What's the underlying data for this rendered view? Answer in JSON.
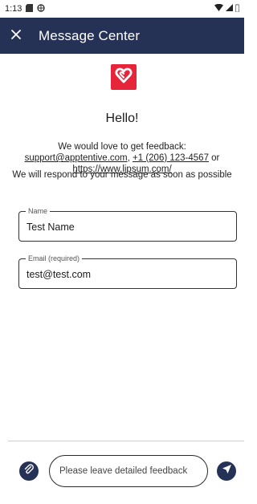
{
  "status_bar": {
    "time": "1:13",
    "icons": [
      "sd-card-icon",
      "vpn-icon",
      "wifi-icon",
      "signal-icon",
      "battery-icon"
    ]
  },
  "app_bar": {
    "title": "Message Center",
    "close_icon": "close-icon",
    "background": "#253155"
  },
  "content": {
    "logo_icon": "heart-logo",
    "brand_color": "#e6243a",
    "greeting": "Hello!",
    "intro_text": "We would love to get feedback: ",
    "email_link": "support@apptentive.com",
    "separator": ", ",
    "phone_link": "+1 (206) 123-4567",
    "or_text": " or ",
    "url_link": "https://www.lipsum.com/",
    "response_text": "We will respond to your message as soon as possible"
  },
  "form": {
    "name": {
      "label": "Name",
      "value": "Test Name"
    },
    "email": {
      "label": "Email (required)",
      "value": "test@test.com"
    }
  },
  "composer": {
    "placeholder": "Please leave detailed feedback",
    "attach_icon": "paperclip-icon",
    "send_icon": "send-icon"
  }
}
